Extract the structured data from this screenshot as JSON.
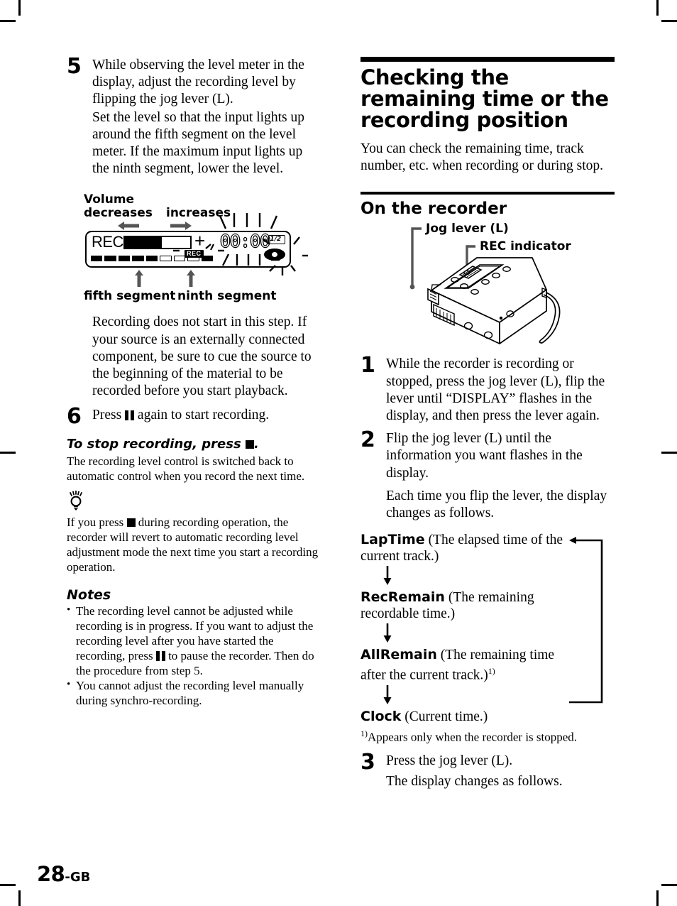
{
  "page": {
    "number": "28",
    "suffix": "-GB"
  },
  "left_column": {
    "step5": {
      "number": "5",
      "paragraphs": [
        "While observing the level meter in the display, adjust the recording level by flipping the jog lever (L).",
        "Set the level so that the input lights up around the fifth segment on the level meter. If the maximum input lights up the ninth segment, lower the level."
      ]
    },
    "meter_figure": {
      "caption_volume": "Volume",
      "caption_decreases": "decreases",
      "caption_increases": "increases",
      "caption_fifth": "fifth segment",
      "caption_ninth": "ninth segment",
      "lcd": {
        "rec_word": "REC",
        "plus_sign": "+",
        "rec_badge": "REC",
        "time": "00:00",
        "tag_text": "1/2"
      }
    },
    "after_figure": {
      "paragraph": "Recording does not start in this step. If your source is an externally connected component, be sure to cue the source to the beginning of the material to be recorded before you start playback."
    },
    "step6": {
      "number": "6",
      "text_before": "Press",
      "icon": "pause-icon",
      "text_after": "again to start recording."
    },
    "stop_section": {
      "heading_before": "To stop recording, press",
      "heading_icon": "stop-icon",
      "heading_after": ".",
      "body": "The recording level control is switched back to automatic control when you record the next time."
    },
    "tip": {
      "icon": "lightbulb-tip-icon",
      "text_before": "If you press",
      "inline_icon": "stop-icon",
      "text_after": "during recording operation, the recorder will revert to automatic recording level adjustment mode the next time you start a recording operation."
    },
    "notes": {
      "title": "Notes",
      "items": [
        {
          "text_before": "The recording level cannot be adjusted while recording is in progress. If you want to adjust the recording level after you have started the recording, press",
          "inline_icon": "pause-icon",
          "text_after": "to pause the recorder. Then do the procedure from step 5."
        },
        {
          "text_before": "You cannot adjust the recording level manually during synchro-recording.",
          "inline_icon": "",
          "text_after": ""
        }
      ]
    }
  },
  "right_column": {
    "section_title": "Checking the remaining time or the recording position",
    "intro": "You can check the remaining time, track number, etc. when recording or during stop.",
    "sub_title": "On the recorder",
    "recorder_figure": {
      "label_jog": "Jog lever (L)",
      "label_rec": "REC indicator"
    },
    "step1": {
      "number": "1",
      "text": "While the recorder is recording or stopped, press the jog lever (L), flip the lever until “DISPLAY” flashes in the display, and then press the lever again."
    },
    "step2": {
      "number": "2",
      "paragraphs": [
        "Flip the jog lever (L) until the information you want flashes in the display.",
        "Each time you flip the lever, the display changes as follows."
      ]
    },
    "cycle": [
      {
        "name": "LapTime",
        "desc": "(The elapsed time of the current track.)",
        "sup": ""
      },
      {
        "name": "RecRemain",
        "desc": "(The remaining recordable time.)",
        "sup": ""
      },
      {
        "name": "AllRemain",
        "desc": "(The remaining time after the current track.)",
        "sup": "1)"
      },
      {
        "name": "Clock",
        "desc": "(Current time.)",
        "sup": ""
      }
    ],
    "footnote": {
      "marker": "1)",
      "text": "Appears only when the recorder is stopped."
    },
    "step3": {
      "number": "3",
      "paragraphs": [
        "Press the jog lever (L).",
        "The display changes as follows."
      ]
    }
  }
}
